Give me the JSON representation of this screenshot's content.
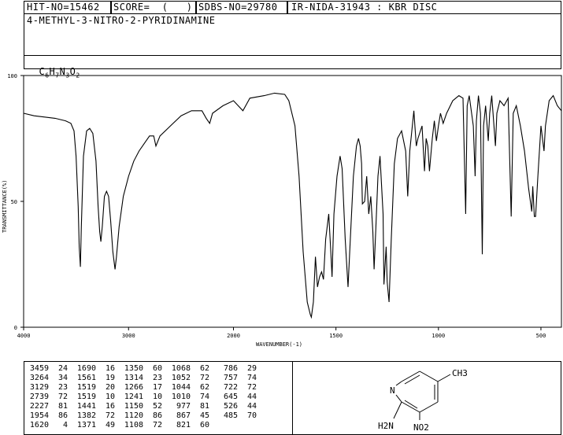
{
  "header": {
    "hit_no": "HIT-NO=15462",
    "score": "SCORE=  (   )",
    "sdbs_no": "SDBS-NO=29780",
    "ir_info": "IR-NIDA-31943 : KBR DISC"
  },
  "compound": {
    "name": "4-METHYL-3-NITRO-2-PYRIDINAMINE",
    "formula": "C6H7N3O2"
  },
  "structure": {
    "ch3": "CH3",
    "n_ring": "N",
    "nh2": "H2N",
    "no2": "NO2"
  },
  "chart_data": {
    "type": "line",
    "xlabel": "WAVENUMBER(-1)",
    "ylabel": "TRANSMITTANCE(%)",
    "xlim": [
      4000,
      400
    ],
    "ylim": [
      0,
      100
    ],
    "x_ticks": [
      "4000",
      "3000",
      "2000",
      "1500",
      "1000",
      "500"
    ],
    "y_ticks": [
      "100",
      "50",
      "0"
    ],
    "x_tick_values": [
      4000,
      3000,
      2000,
      1500,
      1000,
      500
    ],
    "y_tick_values": [
      100,
      50,
      0
    ],
    "series": [
      {
        "points": [
          [
            4000,
            85
          ],
          [
            3900,
            84
          ],
          [
            3800,
            83.5
          ],
          [
            3700,
            83
          ],
          [
            3600,
            82
          ],
          [
            3550,
            81
          ],
          [
            3520,
            78
          ],
          [
            3500,
            68
          ],
          [
            3480,
            48
          ],
          [
            3470,
            32
          ],
          [
            3459,
            24
          ],
          [
            3450,
            40
          ],
          [
            3430,
            68
          ],
          [
            3400,
            78
          ],
          [
            3370,
            79
          ],
          [
            3340,
            77
          ],
          [
            3310,
            66
          ],
          [
            3290,
            48
          ],
          [
            3275,
            38
          ],
          [
            3264,
            34
          ],
          [
            3250,
            40
          ],
          [
            3230,
            52
          ],
          [
            3210,
            54
          ],
          [
            3190,
            52
          ],
          [
            3170,
            42
          ],
          [
            3150,
            30
          ],
          [
            3135,
            25
          ],
          [
            3129,
            23
          ],
          [
            3115,
            28
          ],
          [
            3090,
            40
          ],
          [
            3050,
            52
          ],
          [
            3000,
            60
          ],
          [
            2950,
            66
          ],
          [
            2900,
            70
          ],
          [
            2850,
            73
          ],
          [
            2800,
            76
          ],
          [
            2760,
            76
          ],
          [
            2739,
            72
          ],
          [
            2700,
            76
          ],
          [
            2600,
            80
          ],
          [
            2500,
            84
          ],
          [
            2400,
            86
          ],
          [
            2300,
            86
          ],
          [
            2260,
            83
          ],
          [
            2227,
            81
          ],
          [
            2200,
            85
          ],
          [
            2100,
            88
          ],
          [
            2000,
            90
          ],
          [
            1954,
            86
          ],
          [
            1920,
            91
          ],
          [
            1850,
            92
          ],
          [
            1800,
            93
          ],
          [
            1750,
            92.5
          ],
          [
            1730,
            90
          ],
          [
            1700,
            80
          ],
          [
            1680,
            60
          ],
          [
            1660,
            30
          ],
          [
            1640,
            10
          ],
          [
            1625,
            5
          ],
          [
            1620,
            4
          ],
          [
            1610,
            10
          ],
          [
            1600,
            28
          ],
          [
            1590,
            16
          ],
          [
            1580,
            20
          ],
          [
            1570,
            22
          ],
          [
            1561,
            19
          ],
          [
            1550,
            35
          ],
          [
            1535,
            45
          ],
          [
            1525,
            30
          ],
          [
            1519,
            20
          ],
          [
            1510,
            45
          ],
          [
            1495,
            60
          ],
          [
            1480,
            68
          ],
          [
            1470,
            63
          ],
          [
            1455,
            35
          ],
          [
            1441,
            16
          ],
          [
            1430,
            35
          ],
          [
            1415,
            60
          ],
          [
            1400,
            72
          ],
          [
            1390,
            75
          ],
          [
            1382,
            72
          ],
          [
            1375,
            65
          ],
          [
            1371,
            49
          ],
          [
            1360,
            50
          ],
          [
            1350,
            60
          ],
          [
            1340,
            45
          ],
          [
            1330,
            52
          ],
          [
            1320,
            38
          ],
          [
            1314,
            23
          ],
          [
            1305,
            40
          ],
          [
            1295,
            60
          ],
          [
            1285,
            68
          ],
          [
            1270,
            45
          ],
          [
            1266,
            17
          ],
          [
            1255,
            32
          ],
          [
            1250,
            18
          ],
          [
            1241,
            10
          ],
          [
            1230,
            35
          ],
          [
            1215,
            65
          ],
          [
            1200,
            75
          ],
          [
            1180,
            78
          ],
          [
            1160,
            70
          ],
          [
            1150,
            52
          ],
          [
            1140,
            70
          ],
          [
            1130,
            78
          ],
          [
            1120,
            86
          ],
          [
            1115,
            80
          ],
          [
            1108,
            72
          ],
          [
            1100,
            75
          ],
          [
            1080,
            80
          ],
          [
            1068,
            62
          ],
          [
            1060,
            75
          ],
          [
            1052,
            72
          ],
          [
            1044,
            62
          ],
          [
            1030,
            75
          ],
          [
            1020,
            82
          ],
          [
            1010,
            74
          ],
          [
            1000,
            80
          ],
          [
            990,
            85
          ],
          [
            977,
            81
          ],
          [
            960,
            85
          ],
          [
            930,
            90
          ],
          [
            900,
            92
          ],
          [
            880,
            91
          ],
          [
            867,
            45
          ],
          [
            860,
            88
          ],
          [
            850,
            92
          ],
          [
            840,
            86
          ],
          [
            830,
            80
          ],
          [
            821,
            60
          ],
          [
            815,
            82
          ],
          [
            805,
            92
          ],
          [
            795,
            85
          ],
          [
            786,
            29
          ],
          [
            780,
            80
          ],
          [
            770,
            88
          ],
          [
            757,
            74
          ],
          [
            750,
            85
          ],
          [
            740,
            92
          ],
          [
            722,
            72
          ],
          [
            715,
            85
          ],
          [
            700,
            90
          ],
          [
            680,
            88
          ],
          [
            660,
            91
          ],
          [
            645,
            44
          ],
          [
            635,
            85
          ],
          [
            620,
            88
          ],
          [
            600,
            80
          ],
          [
            580,
            70
          ],
          [
            560,
            55
          ],
          [
            545,
            46
          ],
          [
            540,
            56
          ],
          [
            532,
            44
          ],
          [
            526,
            44
          ],
          [
            515,
            60
          ],
          [
            500,
            80
          ],
          [
            485,
            70
          ],
          [
            478,
            80
          ],
          [
            460,
            90
          ],
          [
            440,
            92
          ],
          [
            420,
            88
          ],
          [
            400,
            86
          ]
        ]
      }
    ]
  },
  "peak_table": [
    [
      [
        "3459",
        "24"
      ],
      [
        "1690",
        "16"
      ],
      [
        "1350",
        "60"
      ],
      [
        "1068",
        "62"
      ],
      [
        "786",
        "29"
      ]
    ],
    [
      [
        "3264",
        "34"
      ],
      [
        "1561",
        "19"
      ],
      [
        "1314",
        "23"
      ],
      [
        "1052",
        "72"
      ],
      [
        "757",
        "74"
      ]
    ],
    [
      [
        "3129",
        "23"
      ],
      [
        "1519",
        "20"
      ],
      [
        "1266",
        "17"
      ],
      [
        "1044",
        "62"
      ],
      [
        "722",
        "72"
      ]
    ],
    [
      [
        "2739",
        "72"
      ],
      [
        "1519",
        "10"
      ],
      [
        "1241",
        "10"
      ],
      [
        "1010",
        "74"
      ],
      [
        "645",
        "44"
      ]
    ],
    [
      [
        "2227",
        "81"
      ],
      [
        "1441",
        "16"
      ],
      [
        "1150",
        "52"
      ],
      [
        "977",
        "81"
      ],
      [
        "526",
        "44"
      ]
    ],
    [
      [
        "1954",
        "86"
      ],
      [
        "1382",
        "72"
      ],
      [
        "1120",
        "86"
      ],
      [
        "867",
        "45"
      ],
      [
        "485",
        "70"
      ]
    ],
    [
      [
        "1620",
        "4"
      ],
      [
        "1371",
        "49"
      ],
      [
        "1108",
        "72"
      ],
      [
        "821",
        "60"
      ],
      [
        "",
        ""
      ]
    ]
  ]
}
